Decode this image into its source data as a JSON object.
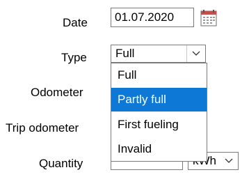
{
  "labels": {
    "date": "Date",
    "type": "Type",
    "odometer": "Odometer",
    "trip_odometer": "Trip odometer",
    "quantity": "Quantity"
  },
  "date": {
    "value": "01.07.2020",
    "icon": "calendar-icon"
  },
  "type_select": {
    "value": "Full",
    "icon": "chevron-down-icon"
  },
  "type_options": [
    {
      "label": "Full"
    },
    {
      "label": "Partly full"
    },
    {
      "label": "First fueling"
    },
    {
      "label": "Invalid"
    }
  ],
  "unit_select": {
    "value": "kWh",
    "icon": "chevron-down-icon"
  },
  "colors": {
    "selection": "#0e78d7",
    "border": "#7a7a7a"
  }
}
